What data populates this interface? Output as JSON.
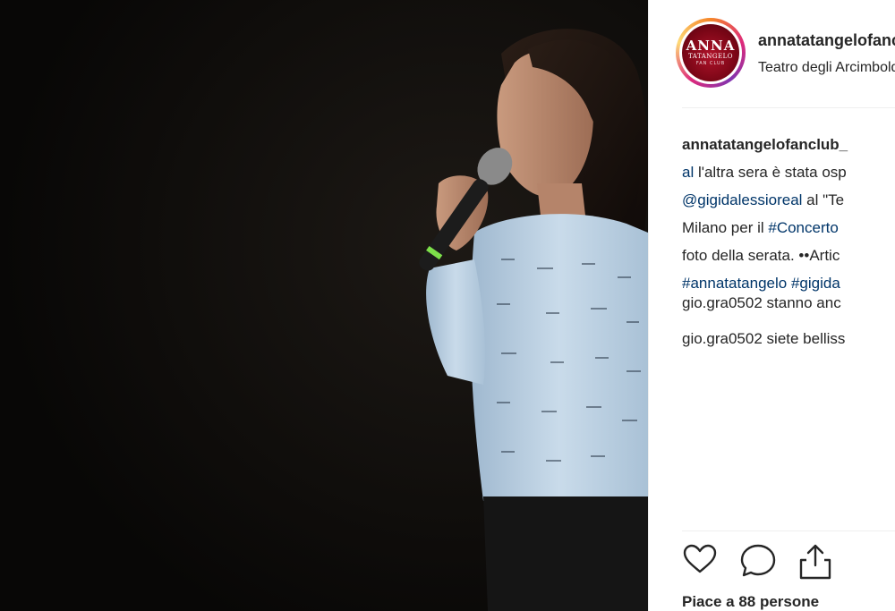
{
  "post": {
    "username": "annatatangelofanclub_",
    "location": "Teatro degli Arcimboldi",
    "avatar_text": {
      "line1": "ANNA",
      "line2": "TATANGELO",
      "line3": "FAN CLUB"
    },
    "photo_alt": "Woman with microphone on stage"
  },
  "caption": {
    "author": "annatatangelofanclub_",
    "line1_link": "al",
    "line1_text": " l'altra sera è stata osp",
    "line2_link": "@gigidalessioreal",
    "line2_text": " al \"Te",
    "line3_text": "Milano per il ",
    "line3_link": "#Concerto",
    "line4_text": "foto della serata. ••Artic",
    "line5_link1": "#annatatangelo",
    "line5_space": " ",
    "line5_link2": "#gigida"
  },
  "comments": [
    {
      "user": "gio.gra0502",
      "text": " stanno anc"
    },
    {
      "user": "gio.gra0502",
      "text": " siete belliss"
    }
  ],
  "actions": {
    "like_icon": "heart-icon",
    "comment_icon": "comment-icon",
    "share_icon": "share-icon"
  },
  "likes_text": "Piace a 88 persone",
  "colors": {
    "link": "#003569",
    "text": "#262626",
    "divider": "#efefef",
    "photo_bg": "#0d0b0a"
  }
}
